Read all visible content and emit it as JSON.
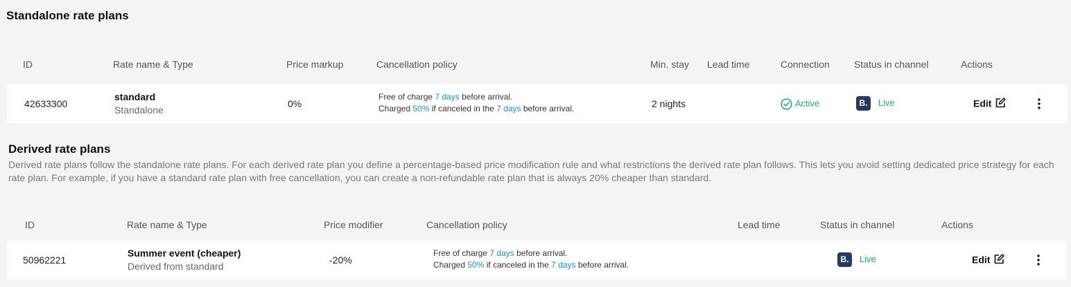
{
  "standalone": {
    "title": "Standalone rate plans",
    "headers": {
      "id": "ID",
      "name": "Rate name & Type",
      "markup": "Price markup",
      "policy": "Cancellation policy",
      "min_stay": "Min. stay",
      "lead_time": "Lead time",
      "connection": "Connection",
      "status": "Status in channel",
      "actions": "Actions"
    },
    "row": {
      "id": "42633300",
      "name": "standard",
      "type": "Standalone",
      "markup": "0%",
      "policy_line1_a": "Free of charge ",
      "policy_line1_hl": "7 days",
      "policy_line1_b": " before arrival.",
      "policy_line2_a": "Charged ",
      "policy_line2_hl1": "50%",
      "policy_line2_b": " if canceled in the ",
      "policy_line2_hl2": "7 days",
      "policy_line2_c": " before arrival.",
      "min_stay": "2 nights",
      "connection": "Active",
      "channel_badge": "B.",
      "status": "Live",
      "edit_label": "Edit"
    }
  },
  "derived": {
    "title": "Derived rate plans",
    "description": "Derived rate plans follow the standalone rate plans. For each derived rate plan you define a percentage-based price modification rule and what restrictions the derived rate plan follows. This lets you avoid setting dedicated price strategy for each rate plan. For example, if you have a standard rate plan with free cancellation, you can create a non-refundable rate plan that is always 20% cheaper than standard.",
    "headers": {
      "id": "ID",
      "name": "Rate name & Type",
      "modifier": "Price modifier",
      "policy": "Cancellation policy",
      "lead_time": "Lead time",
      "status": "Status in channel",
      "actions": "Actions"
    },
    "row": {
      "id": "50962221",
      "name": "Summer event (cheaper)",
      "type": "Derived from standard",
      "modifier": "-20%",
      "policy_line1_a": "Free of charge ",
      "policy_line1_hl": "7 days",
      "policy_line1_b": " before arrival.",
      "policy_line2_a": "Charged ",
      "policy_line2_hl1": "50%",
      "policy_line2_b": " if canceled in the ",
      "policy_line2_hl2": "7 days",
      "policy_line2_c": " before arrival.",
      "channel_badge": "B.",
      "status": "Live",
      "edit_label": "Edit"
    }
  },
  "colors": {
    "accent": "#1a8fd6",
    "success": "#1aa87a",
    "badge_bg": "#243a5e",
    "page_bg": "#f4f4f4"
  },
  "icons": {
    "check": "check-circle-icon",
    "edit": "edit-icon",
    "more": "more-vertical-icon"
  }
}
